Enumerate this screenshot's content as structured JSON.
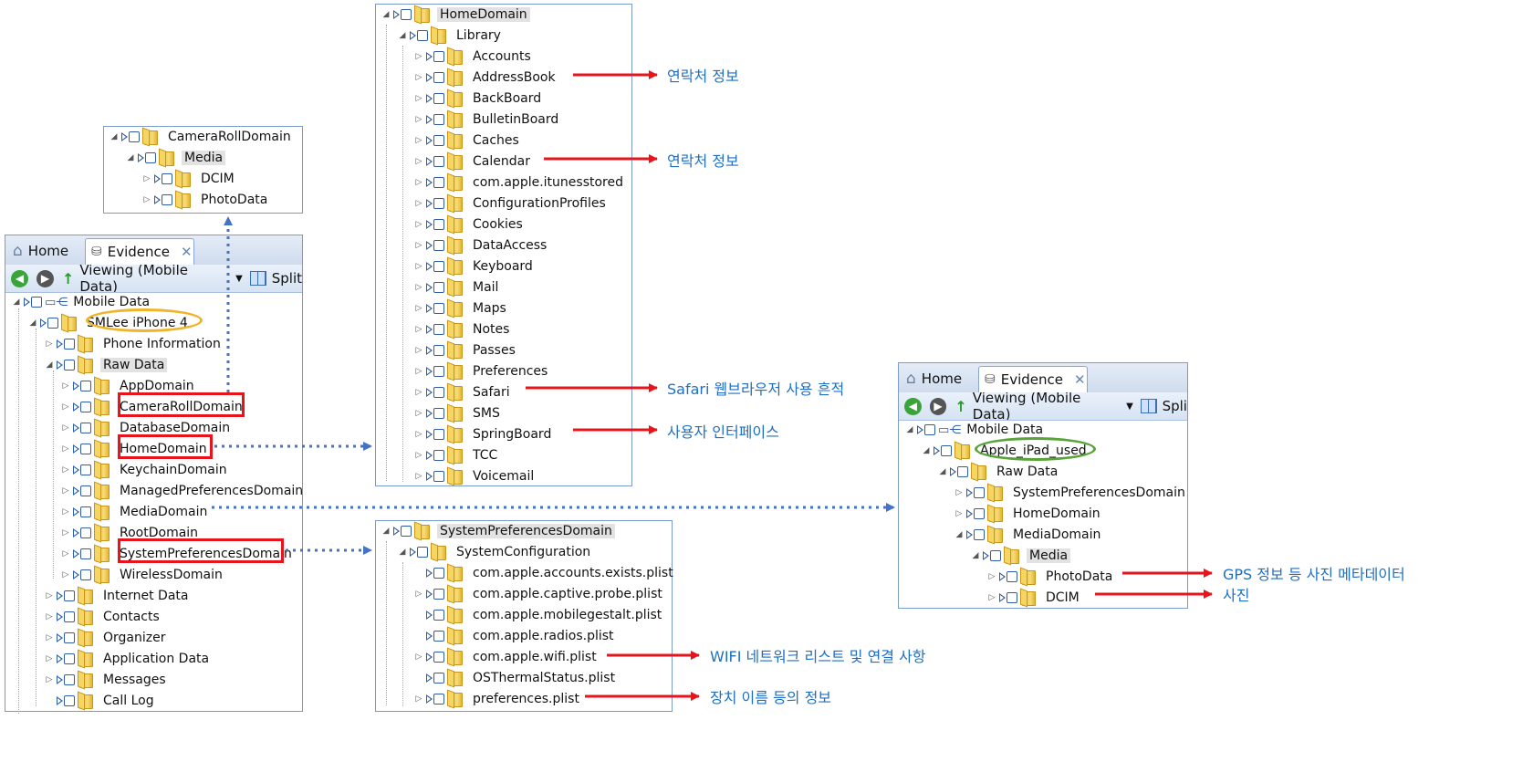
{
  "camera_panel": {
    "rows": [
      "CameraRollDomain",
      "Media",
      "DCIM",
      "PhotoData"
    ]
  },
  "evidence_left": {
    "tabs": {
      "home": "Home",
      "evidence": "Evidence"
    },
    "toolbar": {
      "viewing": "Viewing (Mobile Data)",
      "split": "Split"
    },
    "rows": [
      "Mobile Data",
      "SMLee iPhone 4",
      "Phone Information",
      "Raw Data",
      "AppDomain",
      "CameraRollDomain",
      "DatabaseDomain",
      "HomeDomain",
      "KeychainDomain",
      "ManagedPreferencesDomain",
      "MediaDomain",
      "RootDomain",
      "SystemPreferencesDomain",
      "WirelessDomain",
      "Internet Data",
      "Contacts",
      "Organizer",
      "Application Data",
      "Messages",
      "Call Log"
    ]
  },
  "home_panel": {
    "rows": [
      "HomeDomain",
      "Library",
      "Accounts",
      "AddressBook",
      "BackBoard",
      "BulletinBoard",
      "Caches",
      "Calendar",
      "com.apple.itunesstored",
      "ConfigurationProfiles",
      "Cookies",
      "DataAccess",
      "Keyboard",
      "Mail",
      "Maps",
      "Notes",
      "Passes",
      "Preferences",
      "Safari",
      "SMS",
      "SpringBoard",
      "TCC",
      "Voicemail"
    ]
  },
  "syspref_panel": {
    "rows": [
      "SystemPreferencesDomain",
      "SystemConfiguration",
      "com.apple.accounts.exists.plist",
      "com.apple.captive.probe.plist",
      "com.apple.mobilegestalt.plist",
      "com.apple.radios.plist",
      "com.apple.wifi.plist",
      "OSThermalStatus.plist",
      "preferences.plist"
    ]
  },
  "evidence_right": {
    "tabs": {
      "home": "Home",
      "evidence": "Evidence"
    },
    "toolbar": {
      "viewing": "Viewing (Mobile Data)",
      "split": "Spli"
    },
    "rows": [
      "Mobile Data",
      "Apple_iPad_used",
      "Raw Data",
      "SystemPreferencesDomain",
      "HomeDomain",
      "MediaDomain",
      "Media",
      "PhotoData",
      "DCIM"
    ]
  },
  "annotations": {
    "addressbook": "연락처 정보",
    "calendar": "연락처 정보",
    "safari": "Safari 웹브라우저 사용 흔적",
    "springboard": "사용자 인터페이스",
    "wifi": "WIFI 네트워크 리스트 및 연결 사항",
    "preferences": "장치 이름 등의 정보",
    "photodata": "GPS 정보 등 사진 메타데이터",
    "dcim": "사진"
  },
  "colors": {
    "panel_border": "#7b9cc9",
    "annotation_text": "#1e6fc4",
    "highlight_red": "#e8141c",
    "ellipse_orange": "#f0b429",
    "ellipse_green": "#5aa33a",
    "dotted_connector": "#4472c4",
    "folder": "#f0c94a"
  },
  "icons": {
    "home_tab": "house-icon",
    "evidence_tab": "evidence-drive-icon",
    "back": "back-arrow-icon",
    "forward": "forward-arrow-icon",
    "up": "up-arrow-icon",
    "split": "split-view-icon",
    "mobile": "mobile-data-icon",
    "folder": "folder-icon"
  }
}
